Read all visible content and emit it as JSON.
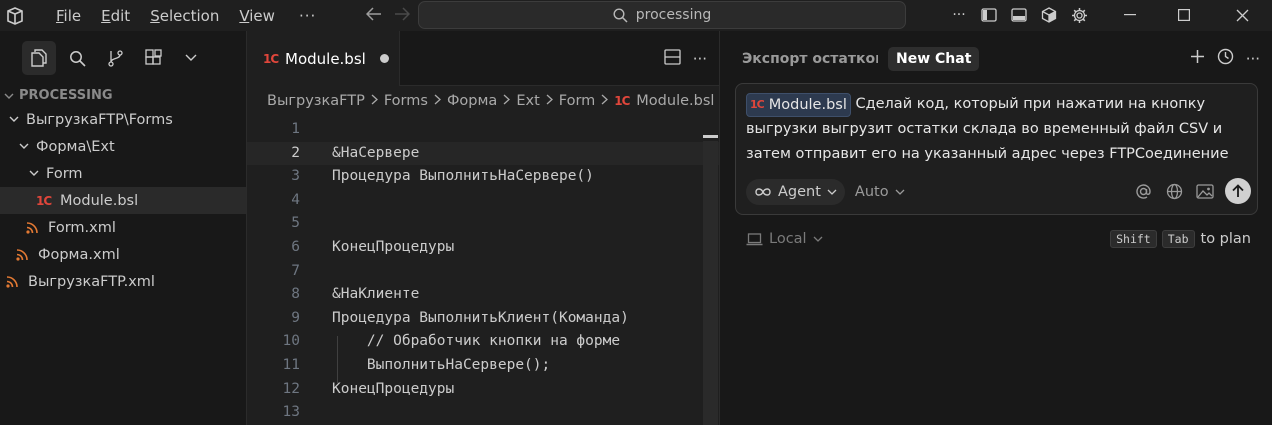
{
  "titlebar": {
    "menu": [
      {
        "label": "File",
        "accel": "F"
      },
      {
        "label": "Edit",
        "accel": "E"
      },
      {
        "label": "Selection",
        "accel": "S"
      },
      {
        "label": "View",
        "accel": "V"
      }
    ],
    "more": "···",
    "search_text": "processing"
  },
  "sidebar": {
    "section_title": "PROCESSING",
    "tree": [
      {
        "label": "ВыгрузкаFTP\\Forms",
        "type": "folder",
        "depth": 1
      },
      {
        "label": "Форма\\Ext",
        "type": "folder",
        "depth": 2
      },
      {
        "label": "Form",
        "type": "folder",
        "depth": 3
      },
      {
        "label": "Module.bsl",
        "type": "1c",
        "depth": 4,
        "selected": true
      },
      {
        "label": "Form.xml",
        "type": "xml",
        "depth": 3
      },
      {
        "label": "Форма.xml",
        "type": "xml",
        "depth": 2
      },
      {
        "label": "ВыгрузкаFTP.xml",
        "type": "xml",
        "depth": 1
      }
    ]
  },
  "editor": {
    "tab_label": "Module.bsl",
    "tab_icon": "1C",
    "breadcrumb": [
      "ВыгрузкаFTP",
      "Forms",
      "Форма",
      "Ext",
      "Form",
      "Module.bsl"
    ],
    "current_line": 2,
    "lines": [
      {
        "n": "1",
        "text": ""
      },
      {
        "n": "2",
        "text": "&НаСервере"
      },
      {
        "n": "3",
        "text": "Процедура ВыполнитьНаСервере()"
      },
      {
        "n": "4",
        "text": ""
      },
      {
        "n": "5",
        "text": ""
      },
      {
        "n": "6",
        "text": "КонецПроцедуры"
      },
      {
        "n": "7",
        "text": ""
      },
      {
        "n": "8",
        "text": "&НаКлиенте"
      },
      {
        "n": "9",
        "text": "Процедура ВыполнитьКлиент(Команда)"
      },
      {
        "n": "10",
        "text": "    // Обработчик кнопки на форме"
      },
      {
        "n": "11",
        "text": "    ВыполнитьНаСервере();"
      },
      {
        "n": "12",
        "text": "КонецПроцедуры"
      },
      {
        "n": "13",
        "text": ""
      }
    ]
  },
  "chat": {
    "old_tab": "Экспорт остатков с",
    "new_tab": "New Chat",
    "file_chip": "Module.bsl",
    "prompt": "Сделай код, который при нажатии на кнопку выгрузки выгрузит остатки склада во временный файл CSV и затем отправит его на указанный адрес через FTPСоединение",
    "agent_label": "Agent",
    "model_label": "Auto",
    "env_label": "Local",
    "hint_keys": [
      "Shift",
      "Tab"
    ],
    "hint_text": "to plan"
  },
  "colors": {
    "accent_1c": "#e0463b",
    "xml_icon": "#e37933",
    "bg": "#181818",
    "editor_bg": "#1f1f1f"
  }
}
